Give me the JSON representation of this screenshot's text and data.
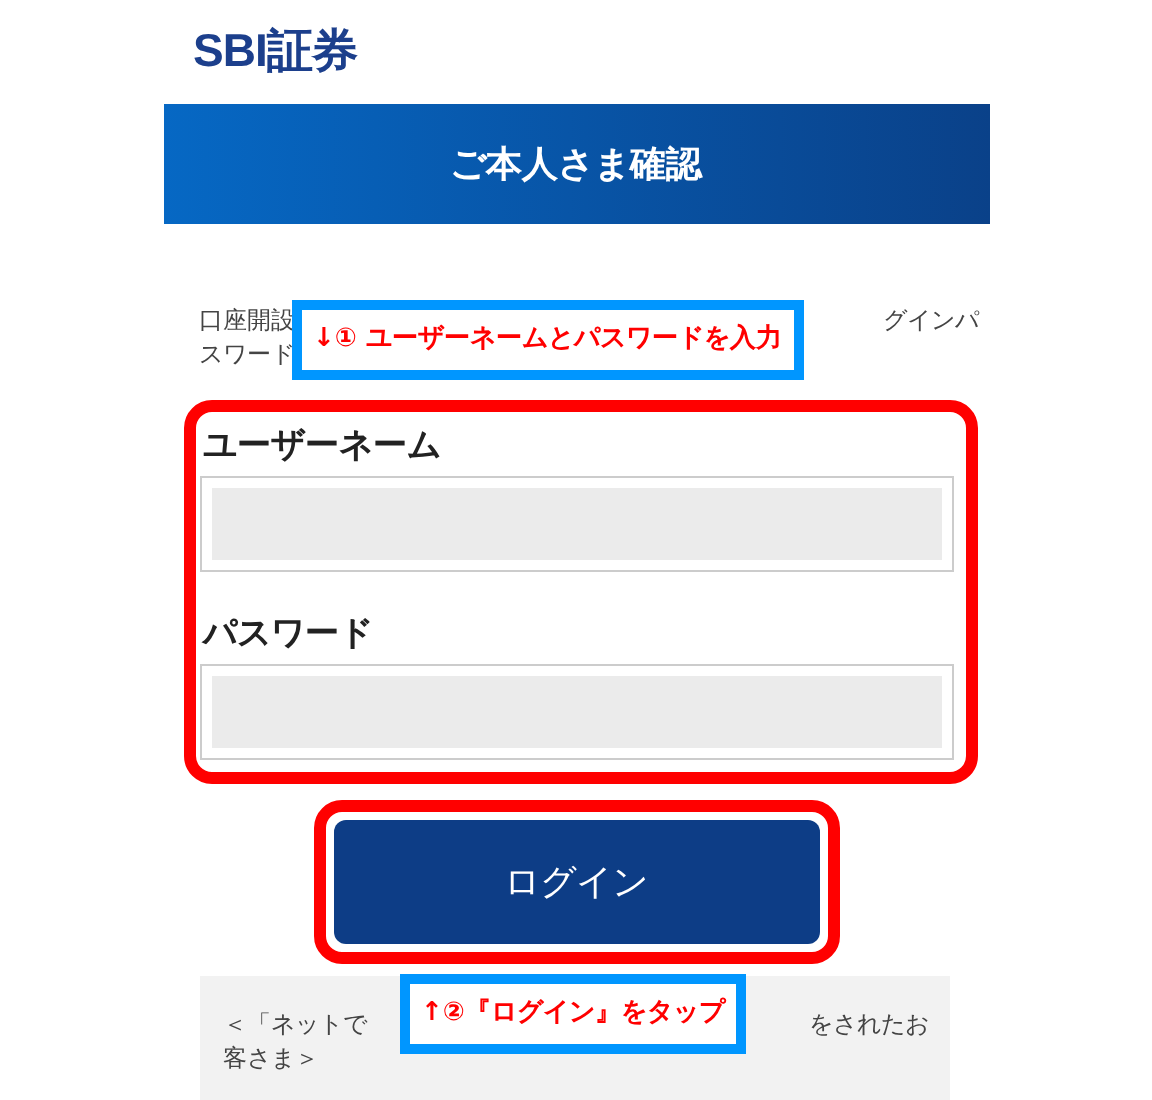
{
  "logo": {
    "text": "SBI証券"
  },
  "header": {
    "title": "ご本人さま確認"
  },
  "intro": {
    "lines": [
      [
        "口座開設",
        "グインパ"
      ],
      [
        "スワード"
      ]
    ]
  },
  "form": {
    "fields": [
      {
        "label": "ユーザーネーム"
      },
      {
        "label": "パスワード"
      }
    ]
  },
  "login_button": {
    "label": "ログイン"
  },
  "notice": {
    "lines": [
      [
        "＜「ネットで",
        "をされたお"
      ],
      [
        "客さま＞"
      ]
    ]
  },
  "callouts": [
    {
      "text": "↓① ユーザーネームとパスワードを入力"
    },
    {
      "text": "↑②『ログイン』をタップ"
    }
  ]
}
